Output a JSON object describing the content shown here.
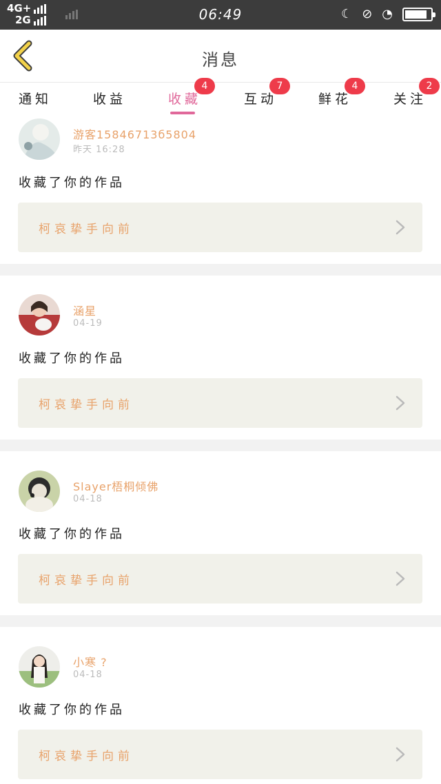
{
  "status_bar": {
    "network_1": "4G+",
    "network_2": "2G",
    "time": "06:49",
    "moon_icon": "☾",
    "mute_icon": "⊘",
    "wifi_icon": "◔",
    "battery_level": 0.85
  },
  "header": {
    "title": "消息"
  },
  "tabs": [
    {
      "label": "通知",
      "badge": ""
    },
    {
      "label": "收益",
      "badge": ""
    },
    {
      "label": "收藏",
      "badge": "4"
    },
    {
      "label": "互动",
      "badge": "7"
    },
    {
      "label": "鲜花",
      "badge": "4"
    },
    {
      "label": "关注",
      "badge": "2"
    }
  ],
  "cards": [
    {
      "username": "游客15846713б5804",
      "time": "昨天 16:28",
      "action": "收藏了你的作品",
      "work_title": "柯哀挚手向前"
    },
    {
      "username": "涵星",
      "time": "04-19",
      "action": "收藏了你的作品",
      "work_title": "柯哀挚手向前"
    },
    {
      "username": "Slayer梧桐倾佛",
      "time": "04-18",
      "action": "收藏了你的作品",
      "work_title": "柯哀挚手向前"
    },
    {
      "username": "小寒 ?",
      "time": "04-18",
      "action": "收藏了你的作品",
      "work_title": "柯哀挚手向前"
    }
  ],
  "colors": {
    "accent": "#e0689a",
    "badge": "#ee3b4a",
    "username": "#e8a26a"
  }
}
